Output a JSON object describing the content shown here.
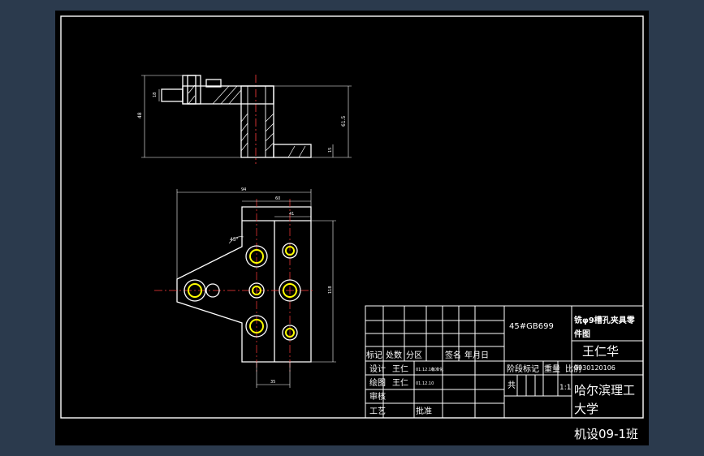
{
  "colors": {
    "background": "#2b3a4d",
    "sheet": "#000000",
    "line": "#ffffff",
    "section_hatch": "#ffffff",
    "center_line": "#ff3b3b",
    "feature": "#ffff00",
    "dimension": "#ffffff"
  },
  "title_block": {
    "material": "45#GB699",
    "part_title_line1": "铣φ9槽孔夹具零",
    "part_title_line2": "件图",
    "author_large": "王仁华",
    "drawing_number": "0930120106",
    "header_cells": [
      "标记",
      "处数",
      "分区",
      "签名",
      "年月日"
    ],
    "row_design_label": "设计",
    "row_design_name": "王仁",
    "row_design_date": "01.12.10",
    "row_design_note": "标准化",
    "row_draw_label": "绘图",
    "row_draw_name": "王仁",
    "row_draw_date": "01.12.10",
    "row_review_label": "审核",
    "row_process_label": "工艺",
    "row_approve_label": "批准",
    "stage_mark_label": "阶段标记",
    "weight_label": "重量",
    "scale_label": "比例",
    "scale_value": "1:1",
    "sheet_label": "共",
    "school_line1": "哈尔滨理工",
    "school_line2": "大学",
    "class_name": "机设09-1班"
  },
  "dimensions": {
    "front_height": "48",
    "front_total": "61.5",
    "front_left_small": "18",
    "front_right_small": "15",
    "top_width": "94",
    "top_width2": "60",
    "top_width3": "41",
    "plan_height": "118",
    "plan_bottom": "35",
    "angle": "45°"
  }
}
